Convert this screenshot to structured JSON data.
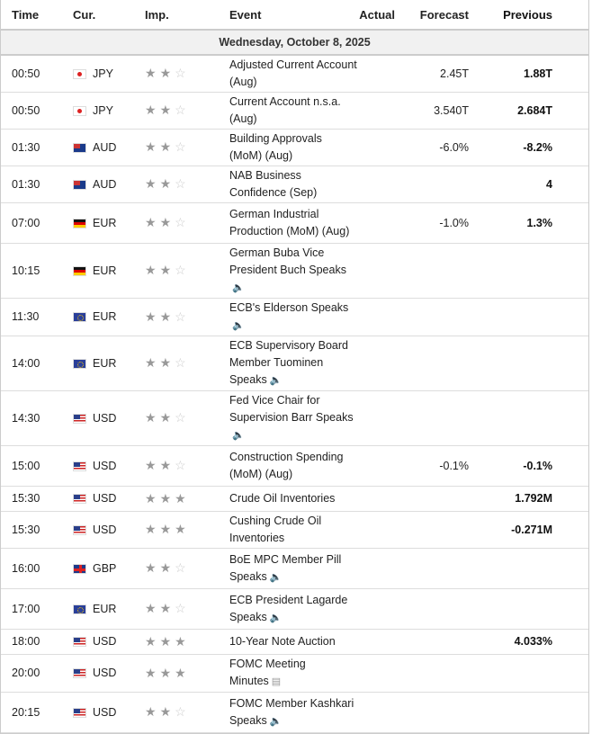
{
  "headers": {
    "time": "Time",
    "cur": "Cur.",
    "imp": "Imp.",
    "event": "Event",
    "actual": "Actual",
    "forecast": "Forecast",
    "previous": "Previous"
  },
  "date": "Wednesday, October 8, 2025",
  "rows": [
    {
      "time": "00:50",
      "cur": "JPY",
      "stars": 2,
      "event": "Adjusted Current Account (Aug)",
      "actual": "",
      "forecast": "2.45T",
      "previous": "1.88T",
      "speech": false,
      "tall": false
    },
    {
      "time": "00:50",
      "cur": "JPY",
      "stars": 2,
      "event": "Current Account n.s.a. (Aug)",
      "actual": "",
      "forecast": "3.540T",
      "previous": "2.684T",
      "speech": false,
      "tall": false
    },
    {
      "time": "01:30",
      "cur": "AUD",
      "stars": 2,
      "event": "Building Approvals (MoM) (Aug)",
      "actual": "",
      "forecast": "-6.0%",
      "previous": "-8.2%",
      "speech": false,
      "tall": false
    },
    {
      "time": "01:30",
      "cur": "AUD",
      "stars": 2,
      "event": "NAB Business Confidence (Sep)",
      "actual": "",
      "forecast": "",
      "previous": "4",
      "speech": false,
      "tall": false
    },
    {
      "time": "07:00",
      "cur": "EUR",
      "flag": "DE",
      "stars": 2,
      "event": "German Industrial Production (MoM) (Aug)",
      "actual": "",
      "forecast": "-1.0%",
      "previous": "1.3%",
      "speech": false,
      "tall": true
    },
    {
      "time": "10:15",
      "cur": "EUR",
      "flag": "DE",
      "stars": 2,
      "event": "German Buba Vice President Buch Speaks",
      "actual": "",
      "forecast": "",
      "previous": "",
      "speech": true,
      "tall": true
    },
    {
      "time": "11:30",
      "cur": "EUR",
      "stars": 2,
      "event": "ECB's Elderson Speaks",
      "actual": "",
      "forecast": "",
      "previous": "",
      "speech": true,
      "tall": false
    },
    {
      "time": "14:00",
      "cur": "EUR",
      "stars": 2,
      "event": "ECB Supervisory Board Member Tuominen Speaks",
      "actual": "",
      "forecast": "",
      "previous": "",
      "speech": true,
      "tall": true
    },
    {
      "time": "14:30",
      "cur": "USD",
      "stars": 2,
      "event": "Fed Vice Chair for Supervision Barr Speaks",
      "actual": "",
      "forecast": "",
      "previous": "",
      "speech": true,
      "tall": true
    },
    {
      "time": "15:00",
      "cur": "USD",
      "stars": 2,
      "event": "Construction Spending (MoM) (Aug)",
      "actual": "",
      "forecast": "-0.1%",
      "previous": "-0.1%",
      "speech": false,
      "tall": true
    },
    {
      "time": "15:30",
      "cur": "USD",
      "stars": 3,
      "event": "Crude Oil Inventories",
      "actual": "",
      "forecast": "",
      "previous": "1.792M",
      "speech": false,
      "tall": false
    },
    {
      "time": "15:30",
      "cur": "USD",
      "stars": 3,
      "event": "Cushing Crude Oil Inventories",
      "actual": "",
      "forecast": "",
      "previous": "-0.271M",
      "speech": false,
      "tall": false
    },
    {
      "time": "16:00",
      "cur": "GBP",
      "stars": 2,
      "event": "BoE MPC Member Pill Speaks",
      "actual": "",
      "forecast": "",
      "previous": "",
      "speech": true,
      "tall": true
    },
    {
      "time": "17:00",
      "cur": "EUR",
      "stars": 2,
      "event": "ECB President Lagarde Speaks",
      "actual": "",
      "forecast": "",
      "previous": "",
      "speech": true,
      "tall": true
    },
    {
      "time": "18:00",
      "cur": "USD",
      "stars": 3,
      "event": "10-Year Note Auction",
      "actual": "",
      "forecast": "",
      "previous": "4.033%",
      "speech": false,
      "tall": false
    },
    {
      "time": "20:00",
      "cur": "USD",
      "stars": 3,
      "event": "FOMC Meeting Minutes",
      "actual": "",
      "forecast": "",
      "previous": "",
      "speech": false,
      "doc": true,
      "tall": false
    },
    {
      "time": "20:15",
      "cur": "USD",
      "stars": 2,
      "event": "FOMC Member Kashkari Speaks",
      "actual": "",
      "forecast": "",
      "previous": "",
      "speech": true,
      "tall": true
    }
  ]
}
